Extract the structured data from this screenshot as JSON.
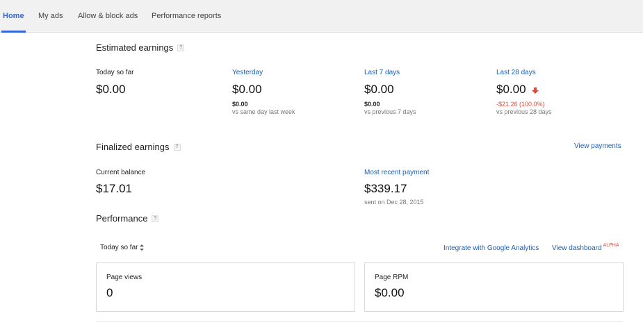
{
  "tabs": [
    {
      "label": "Home",
      "active": true
    },
    {
      "label": "My ads",
      "active": false
    },
    {
      "label": "Allow & block ads",
      "active": false
    },
    {
      "label": "Performance reports",
      "active": false
    }
  ],
  "help_glyph": "?",
  "estimated": {
    "title": "Estimated earnings",
    "today": {
      "label": "Today so far",
      "value": "$0.00"
    },
    "yesterday": {
      "label": "Yesterday",
      "value": "$0.00",
      "change": "$0.00",
      "compare": "vs same day last week"
    },
    "last7": {
      "label": "Last 7 days",
      "value": "$0.00",
      "change": "$0.00",
      "compare": "vs previous 7 days"
    },
    "last28": {
      "label": "Last 28 days",
      "value": "$0.00",
      "change": "-$21.26 (100.0%)",
      "compare": "vs previous 28 days",
      "trend": "down",
      "trend_color": "#dd4b39"
    }
  },
  "finalized": {
    "title": "Finalized earnings",
    "view_payments": "View payments",
    "balance": {
      "label": "Current balance",
      "value": "$17.01"
    },
    "recent_payment": {
      "label": "Most recent payment",
      "value": "$339.17",
      "note": "sent on Dec 28, 2015"
    }
  },
  "performance": {
    "title": "Performance",
    "range": "Today so far",
    "integrate_link": "Integrate with Google Analytics",
    "dashboard_link": "View dashboard",
    "dashboard_badge": "ALPHA",
    "cards": [
      {
        "label": "Page views",
        "value": "0"
      },
      {
        "label": "Page RPM",
        "value": "$0.00"
      }
    ]
  },
  "colors": {
    "accent": "#3367d6",
    "link": "#1a5fb4",
    "negative": "#dd4b39"
  }
}
